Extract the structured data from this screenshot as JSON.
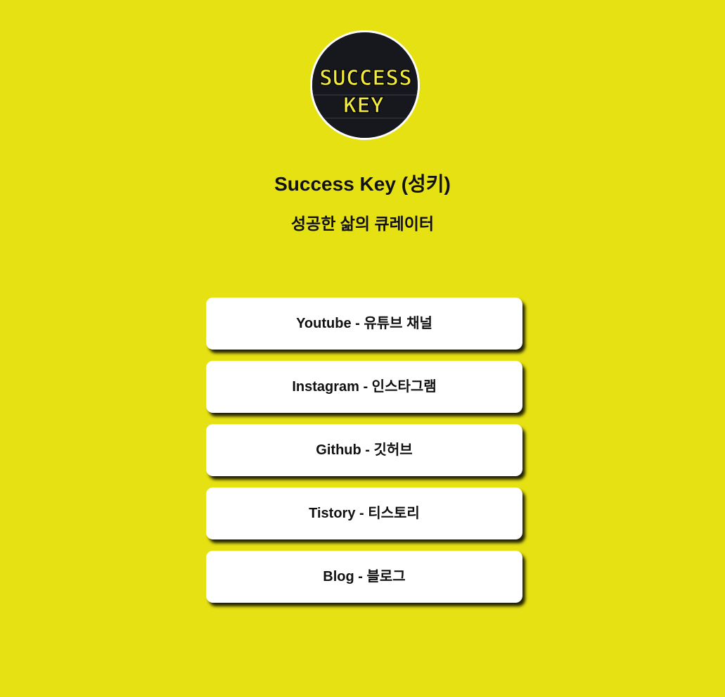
{
  "profile": {
    "avatar_text_line1": "SUCCESS",
    "avatar_text_line2": "KEY",
    "name": "Success Key (성키)",
    "tagline": "성공한 삶의 큐레이터"
  },
  "links": [
    {
      "label": "Youtube - 유튜브 채널"
    },
    {
      "label": "Instagram - 인스타그램"
    },
    {
      "label": "Github - 깃허브"
    },
    {
      "label": "Tistory - 티스토리"
    },
    {
      "label": "Blog - 블로그"
    }
  ],
  "colors": {
    "background": "#e6e112",
    "button": "#ffffff",
    "text": "#111111",
    "logo_fill": "#f2ea3a",
    "logo_dark": "#17181d"
  }
}
